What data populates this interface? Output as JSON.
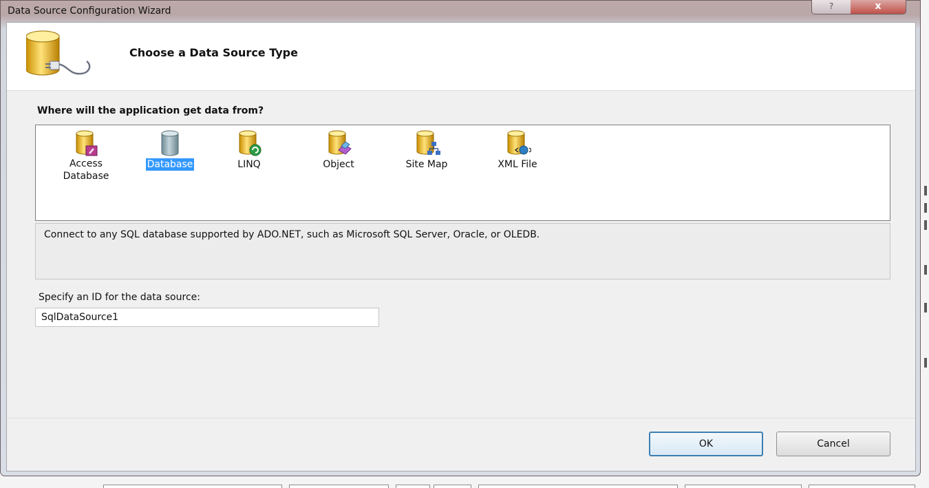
{
  "window": {
    "title": "Data Source Configuration Wizard",
    "help_label": "?",
    "close_label": "x"
  },
  "header": {
    "title": "Choose a Data Source Type",
    "icon": "database-plug-icon"
  },
  "question": "Where will the application get data from?",
  "types": [
    {
      "label": "Access Database",
      "icon": "access-database-icon",
      "selected": false
    },
    {
      "label": "Database",
      "icon": "database-icon",
      "selected": true
    },
    {
      "label": "LINQ",
      "icon": "linq-icon",
      "selected": false
    },
    {
      "label": "Object",
      "icon": "object-icon",
      "selected": false
    },
    {
      "label": "Site Map",
      "icon": "site-map-icon",
      "selected": false
    },
    {
      "label": "XML File",
      "icon": "xml-file-icon",
      "selected": false
    }
  ],
  "description": "Connect to any SQL database supported by ADO.NET, such as Microsoft SQL Server, Oracle, or OLEDB.",
  "id_section": {
    "label": "Specify an ID for the data source:",
    "value": "SqlDataSource1"
  },
  "buttons": {
    "ok": "OK",
    "cancel": "Cancel"
  },
  "colors": {
    "selection": "#3399ff",
    "cylinder_gold": "#e9b70f",
    "cylinder_gray": "#8aa3ad"
  }
}
